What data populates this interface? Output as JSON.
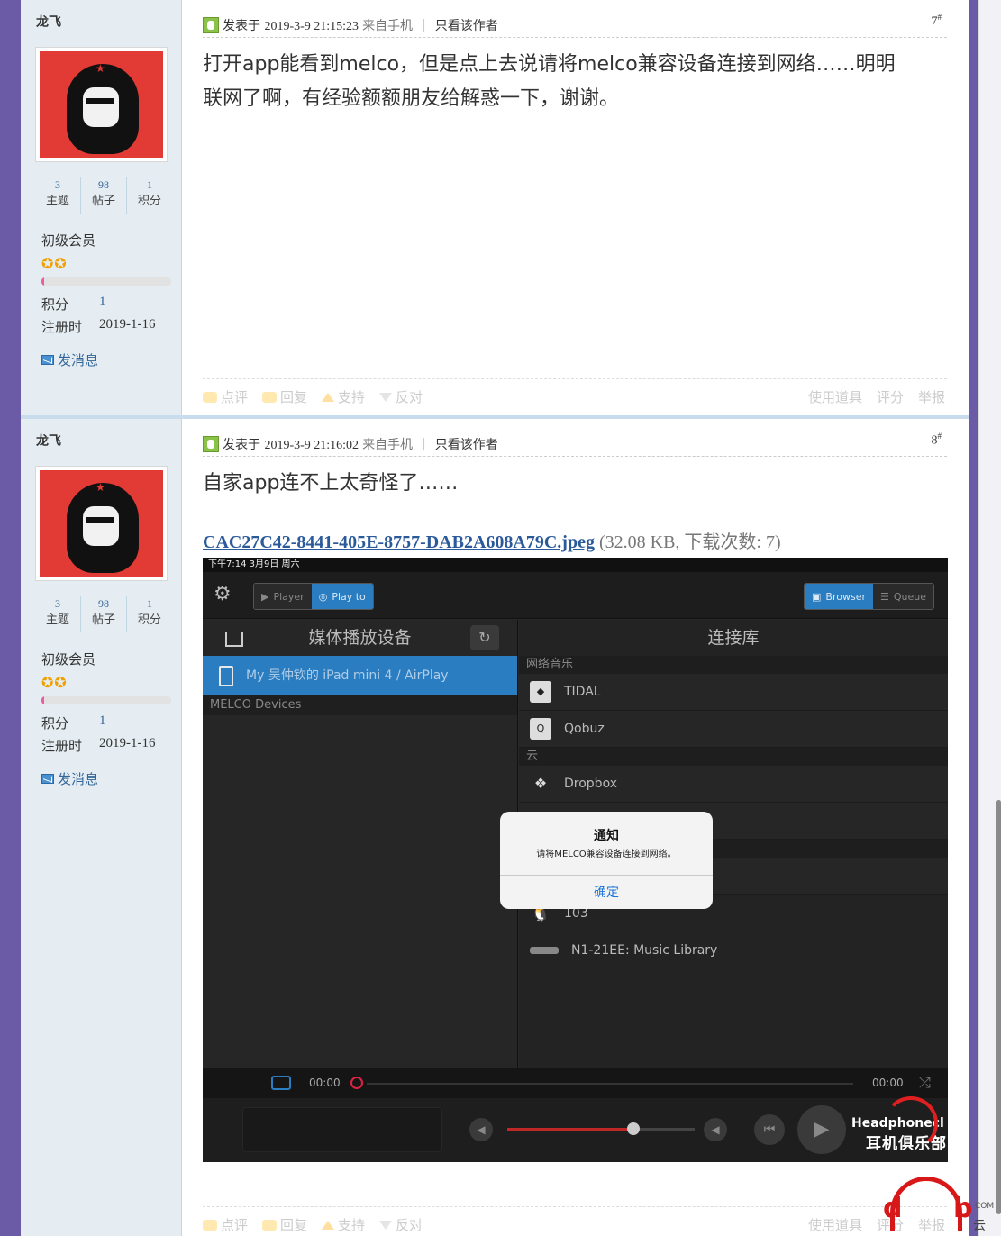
{
  "posts": [
    {
      "author": "龙飞",
      "stats": [
        {
          "n": "3",
          "l": "主题"
        },
        {
          "n": "98",
          "l": "帖子"
        },
        {
          "n": "1",
          "l": "积分"
        }
      ],
      "rank": "初级会员",
      "stars": "✪✪",
      "progress": 0.02,
      "points_label": "积分",
      "points": "1",
      "reg_label": "注册时",
      "reg_date": "2019-1-16",
      "send_msg": "发消息",
      "posted_prefix": "发表于",
      "posted_time": "2019-3-9 21:15:23",
      "from": "来自手机",
      "only_author": "只看该作者",
      "floor": "7",
      "floor_mark": "#",
      "content_lines": [
        "打开app能看到melco，但是点上去说请将melco兼容设备连接到网络……明明",
        "联网了啊，有经验额额朋友给解惑一下，谢谢。"
      ],
      "footer": {
        "comment": "点评",
        "reply": "回复",
        "support": "支持",
        "oppose": "反对",
        "tools": "使用道具",
        "rate": "评分",
        "report": "举报"
      }
    },
    {
      "author": "龙飞",
      "stats": [
        {
          "n": "3",
          "l": "主题"
        },
        {
          "n": "98",
          "l": "帖子"
        },
        {
          "n": "1",
          "l": "积分"
        }
      ],
      "rank": "初级会员",
      "stars": "✪✪",
      "progress": 0.02,
      "points_label": "积分",
      "points": "1",
      "reg_label": "注册时",
      "reg_date": "2019-1-16",
      "send_msg": "发消息",
      "posted_prefix": "发表于",
      "posted_time": "2019-3-9 21:16:02",
      "from": "来自手机",
      "only_author": "只看该作者",
      "floor": "8",
      "floor_mark": "#",
      "content_lines": [
        "自家app连不上太奇怪了……"
      ],
      "attachment": {
        "name": "CAC27C42-8441-405E-8757-DAB2A608A79C.jpeg",
        "meta": "(32.08 KB, 下载次数: 7)"
      },
      "footer": {
        "comment": "点评",
        "reply": "回复",
        "support": "支持",
        "oppose": "反对",
        "tools": "使用道具",
        "rate": "评分",
        "report": "举报"
      }
    }
  ],
  "screenshot": {
    "status": "下午7:14   3月9日 周六",
    "player": "Player",
    "playto": "Play to",
    "browser": "Browser",
    "queue": "Queue",
    "left_title": "媒体播放设备",
    "selected_device": "My 吴仲钦的 iPad mini 4 / AirPlay",
    "melco_group": "MELCO Devices",
    "right_title": "连接库",
    "net_music": "网络音乐",
    "tidal": "TIDAL",
    "qobuz": "Qobuz",
    "cloud": "云",
    "dropbox": "Dropbox",
    "linux": "103",
    "n1": "N1-21EE: Music Library",
    "dialog_title": "通知",
    "dialog_msg": "请将MELCO兼容设备连接到网络。",
    "dialog_ok": "确定",
    "time_start": "00:00",
    "time_end": "00:00",
    "watermark_en": "Headphonecl",
    "watermark_cn": "耳机俱乐部"
  },
  "logo": {
    "d": "d",
    "b": "b",
    "com": "COM",
    "yun": "云"
  }
}
